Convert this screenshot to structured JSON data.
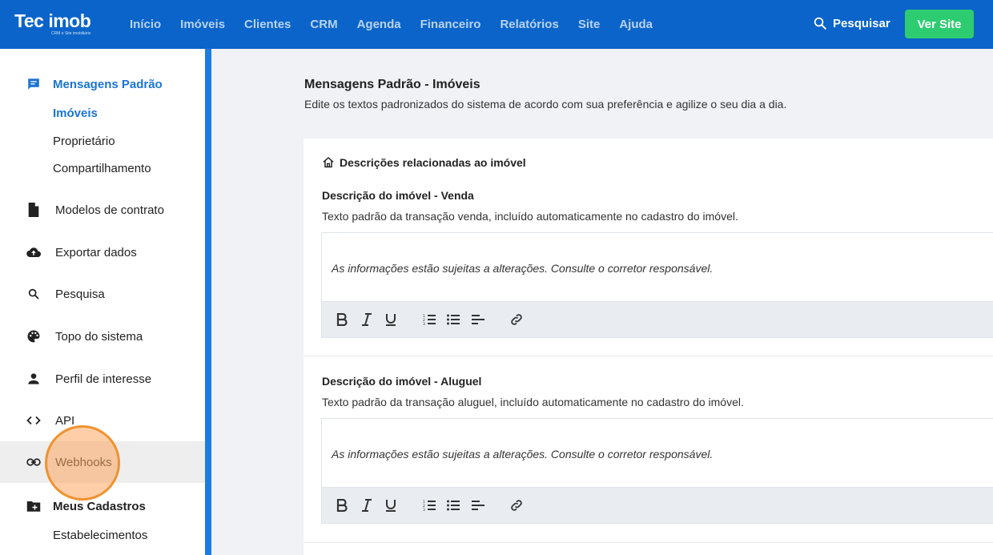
{
  "logo": {
    "main": "Tec imob",
    "sub": "CRM e Site imobiliário"
  },
  "nav": [
    "Início",
    "Imóveis",
    "Clientes",
    "CRM",
    "Agenda",
    "Financeiro",
    "Relatórios",
    "Site",
    "Ajuda"
  ],
  "header": {
    "search_label": "Pesquisar",
    "ver_site": "Ver Site"
  },
  "sidebar": {
    "group1": {
      "label": "Mensagens Padrão",
      "icon": "message-icon",
      "items": [
        "Imóveis",
        "Proprietário",
        "Compartilhamento"
      ]
    },
    "items": [
      {
        "label": "Modelos de contrato",
        "icon": "document-icon"
      },
      {
        "label": "Exportar dados",
        "icon": "cloud-upload-icon"
      },
      {
        "label": "Pesquisa",
        "icon": "search-icon"
      },
      {
        "label": "Topo do sistema",
        "icon": "palette-icon"
      },
      {
        "label": "Perfil de interesse",
        "icon": "person-icon"
      },
      {
        "label": "API",
        "icon": "code-icon"
      },
      {
        "label": "Webhooks",
        "icon": "link-icon"
      }
    ],
    "group2": {
      "label": "Meus Cadastros",
      "icon": "folder-add-icon",
      "items": [
        "Estabelecimentos"
      ]
    }
  },
  "main": {
    "title": "Mensagens Padrão - Imóveis",
    "description": "Edite os textos padronizados do sistema de acordo com sua preferência e agilize o seu dia a dia.",
    "section_title": "Descrições relacionadas ao imóvel",
    "fields": [
      {
        "title": "Descrição do imóvel - Venda",
        "description": "Texto padrão da transação venda, incluído automaticamente no cadastro do imóvel.",
        "value": "As informações estão sujeitas a alterações. Consulte o corretor responsável."
      },
      {
        "title": "Descrição do imóvel - Aluguel",
        "description": "Texto padrão da transação aluguel, incluído automaticamente no cadastro do imóvel.",
        "value": "As informações estão sujeitas a alterações. Consulte o corretor responsável."
      }
    ]
  },
  "colors": {
    "topbar": "#0a64c9",
    "accent": "#1a73d4",
    "button_green": "#2ecc71",
    "cursor": "#f0922f"
  }
}
